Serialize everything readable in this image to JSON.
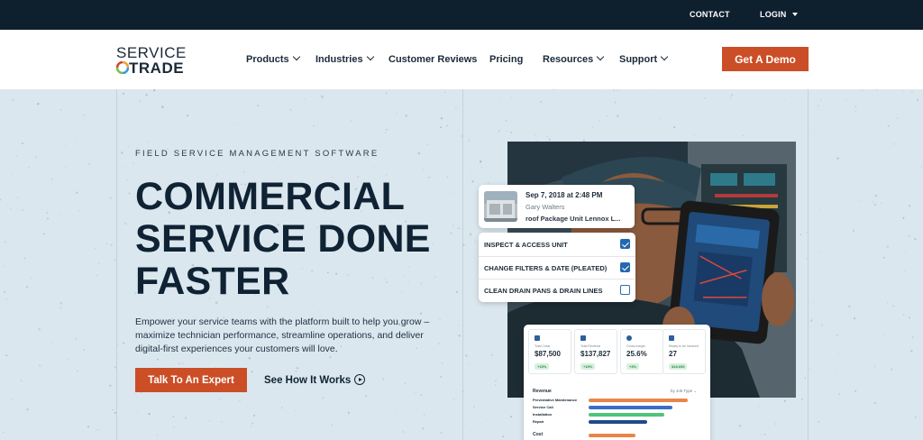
{
  "topbar": {
    "contact": "CONTACT",
    "login": "LOGIN"
  },
  "logo": {
    "line1": "SERVICE",
    "line2": "TRADE",
    "ring_colors": [
      "#e8a33a",
      "#3a9ad9",
      "#7bbf4a",
      "#cf4c2a"
    ]
  },
  "nav": {
    "items": [
      {
        "label": "Products",
        "has_dropdown": true
      },
      {
        "label": "Industries",
        "has_dropdown": true
      },
      {
        "label": "Customer Reviews",
        "has_dropdown": false
      },
      {
        "label": "Pricing",
        "has_dropdown": false
      },
      {
        "label": "Resources",
        "has_dropdown": true
      },
      {
        "label": "Support",
        "has_dropdown": true
      }
    ],
    "cta": "Get A Demo"
  },
  "hero": {
    "eyebrow": "FIELD SERVICE MANAGEMENT SOFTWARE",
    "headline": [
      "COMMERCIAL",
      "SERVICE DONE",
      "FASTER"
    ],
    "description": "Empower your service teams with the platform built to help you grow – maximize technician performance, streamline operations, and deliver digital-first experiences your customers will love.",
    "primary_cta": "Talk To An Expert",
    "secondary_cta": "See How It Works"
  },
  "info_card": {
    "date": "Sep 7, 2018 at 2:48 PM",
    "name": "Gary Walters",
    "job": "roof Package Unit Lennox L..."
  },
  "checklist": [
    {
      "label": "INSPECT & ACCESS UNIT",
      "checked": true
    },
    {
      "label": "CHANGE FILTERS & DATE (PLEATED)",
      "checked": true
    },
    {
      "label": "CLEAN DRAIN PANS & DRAIN LINES",
      "checked": false
    }
  ],
  "dashboard": {
    "metrics": [
      {
        "label": "Total Costs",
        "value": "$87,500",
        "badge": "+15%"
      },
      {
        "label": "Total Revenue",
        "value": "$137,827",
        "badge": "+15%"
      },
      {
        "label": "Gross margin",
        "value": "25.6%",
        "badge": "+3%"
      },
      {
        "label": "Ready to be Invoiced",
        "value": "27",
        "badge": "$18,695"
      }
    ],
    "revenue_title": "Revenue",
    "revenue_filter": "by Job Type",
    "revenue_rows": [
      {
        "label": "Preventative Maintenance",
        "value": 0.95,
        "color": "#e8854a"
      },
      {
        "label": "Service Call",
        "value": 0.8,
        "color": "#3a6fc4"
      },
      {
        "label": "Installation",
        "value": 0.72,
        "color": "#4fc47a"
      },
      {
        "label": "Repair",
        "value": 0.56,
        "color": "#1e4a8a"
      }
    ],
    "cost_title": "Cost"
  }
}
